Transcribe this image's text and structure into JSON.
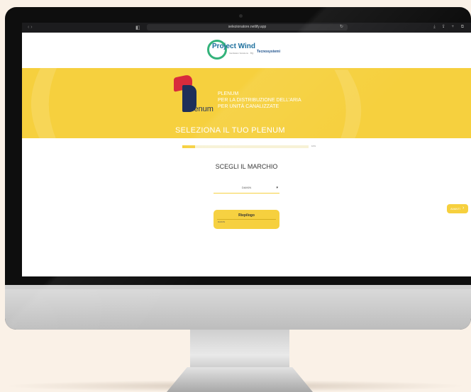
{
  "browser": {
    "url": "selezionatore.netlify.app",
    "nav_arrows": "‹  ›",
    "sidebar_icon": "◧",
    "reload_icon": "↻",
    "toolbar_icons": "⤓ ⇪ + ⧉"
  },
  "site_header": {
    "logo_title": "Project Wind",
    "logo_sub": "Ventilation Solutions",
    "by": "by",
    "partner": "Tecnosystemi"
  },
  "banner": {
    "logo_text": "lenum",
    "line1": "PLENUM",
    "line2": "PER LA DISTRIBUZIONE DELL'ARIA",
    "line3": "PER UNITÀ CANALIZZATE",
    "cta": "SELEZIONA IL TUO PLENUM",
    "color": "#f6d03e"
  },
  "progress": {
    "value": 0.1,
    "label": "10%"
  },
  "step": {
    "title": "SCEGLI IL MARCHIO",
    "brand_select": "DAIKIN"
  },
  "summary": {
    "title": "Riepilogo",
    "items": [
      "DAIKIN"
    ]
  },
  "nav": {
    "next_label": "AVANTI",
    "next_icon": "›"
  }
}
